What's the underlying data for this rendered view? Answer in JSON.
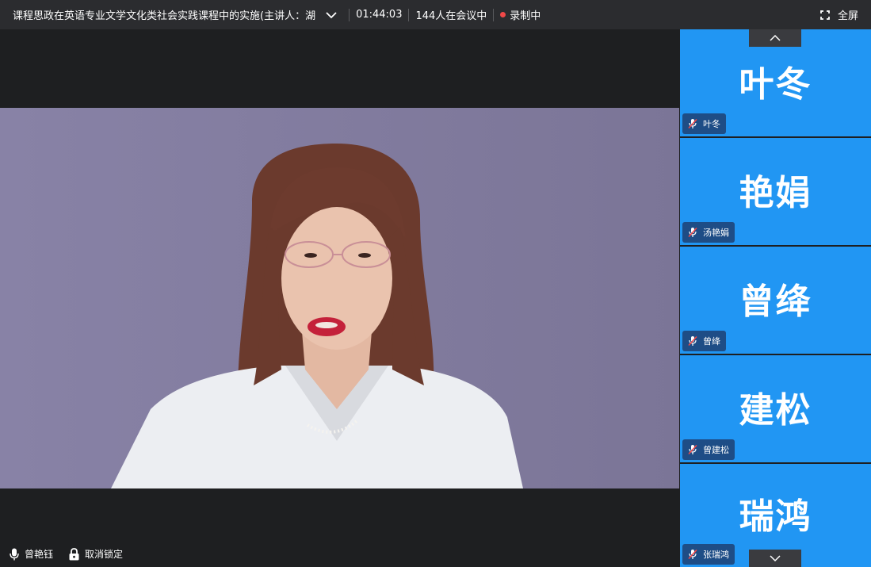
{
  "header": {
    "meeting_title": "课程思政在英语专业文学文化类社会实践课程中的实施(主讲人：湖",
    "elapsed_time": "01:44:03",
    "participants": "144人在会议中",
    "recording_status": "录制中",
    "fullscreen_label": "全屏"
  },
  "stage": {
    "speaker_name": "曾艳钰",
    "unlock_label": "取消锁定"
  },
  "participants_panel": {
    "tiles": [
      {
        "avatar_text": "叶冬",
        "name": "叶冬"
      },
      {
        "avatar_text": "艳娟",
        "name": "汤艳娟"
      },
      {
        "avatar_text": "曾绛",
        "name": "曾绛"
      },
      {
        "avatar_text": "建松",
        "name": "曾建松"
      },
      {
        "avatar_text": "瑞鸿",
        "name": "张瑞鸿"
      }
    ]
  },
  "icons": {
    "header": [
      "chevron-down-icon",
      "record-dot-icon",
      "fullscreen-icon"
    ],
    "stage": [
      "microphone-icon",
      "lock-icon",
      "speaker-video-feed"
    ],
    "panel": [
      "chevron-up-icon",
      "muted-microphone-icon",
      "chevron-down-icon"
    ]
  },
  "colors": {
    "tile_blue": "#2196f3",
    "name_tag": "#1e4d86",
    "top_bar": "#2b2c2f",
    "background": "#1e1f21",
    "video_backdrop": "#807b9d",
    "recording_red": "#f04848"
  }
}
